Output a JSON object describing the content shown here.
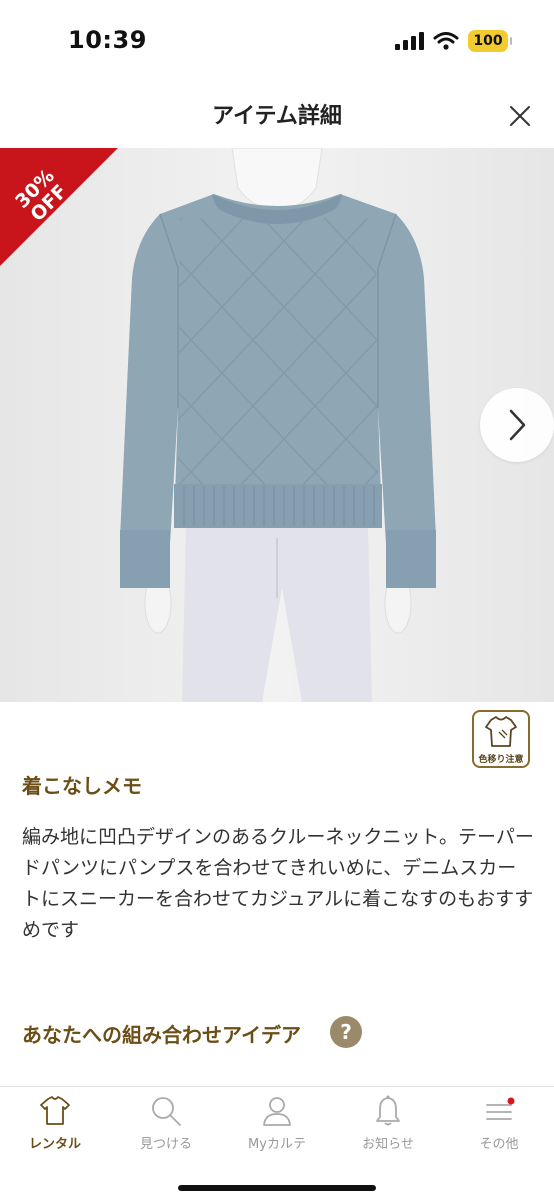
{
  "status": {
    "time": "10:39",
    "battery": "100"
  },
  "header": {
    "title": "アイテム詳細"
  },
  "product": {
    "discount_line1": "30%",
    "discount_line2": "OFF",
    "caution_label": "色移り注意"
  },
  "memo": {
    "title": "着こなしメモ",
    "text": "編み地に凹凸デザインのあるクルーネックニット。テーパードパンツにパンプスを合わせてきれいめに、デニムスカートにスニーカーを合わせてカジュアルに着こなすのもおすすめです"
  },
  "ideas": {
    "title": "あなたへの組み合わせアイデア",
    "help_icon": "?"
  },
  "tabs": [
    {
      "label": "レンタル",
      "icon": "shirt-icon"
    },
    {
      "label": "見つける",
      "icon": "search-icon"
    },
    {
      "label": "Myカルテ",
      "icon": "person-icon"
    },
    {
      "label": "お知らせ",
      "icon": "bell-icon"
    },
    {
      "label": "その他",
      "icon": "menu-icon"
    }
  ],
  "colors": {
    "accent": "#6b4e16",
    "badge": "#c8151b",
    "sweater": "#8fa6b5"
  }
}
